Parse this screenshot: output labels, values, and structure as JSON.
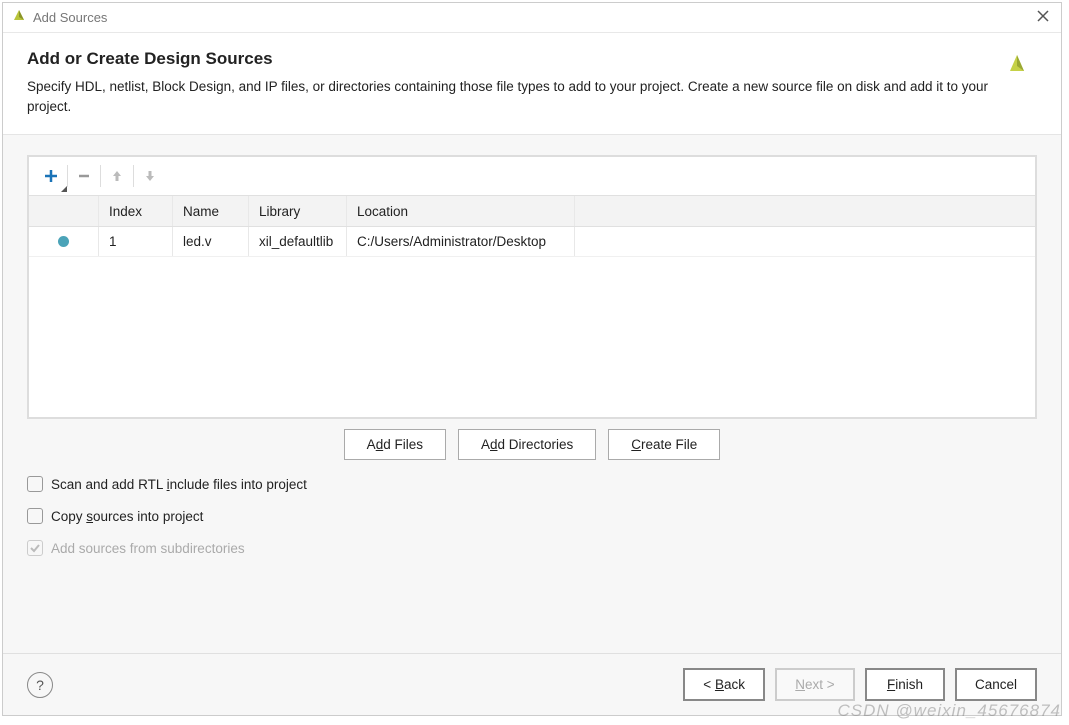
{
  "titlebar": {
    "title": "Add Sources"
  },
  "header": {
    "heading": "Add or Create Design Sources",
    "description": "Specify HDL, netlist, Block Design, and IP files, or directories containing those file types to add to your project. Create a new source file on disk and add it to your project."
  },
  "table": {
    "columns": {
      "index": "Index",
      "name": "Name",
      "library": "Library",
      "location": "Location"
    },
    "rows": [
      {
        "index": "1",
        "name": "led.v",
        "library": "xil_defaultlib",
        "location": "C:/Users/Administrator/Desktop"
      }
    ]
  },
  "actions": {
    "add_files_pre": "A",
    "add_files_u": "d",
    "add_files_post": "d Files",
    "add_dirs_pre": "A",
    "add_dirs_u": "d",
    "add_dirs_post": "d Directories",
    "create_file_pre": "",
    "create_file_u": "C",
    "create_file_post": "reate File"
  },
  "checkboxes": {
    "scan_pre": "Scan and add RTL ",
    "scan_u": "i",
    "scan_post": "nclude files into project",
    "copy_pre": "Copy ",
    "copy_u": "s",
    "copy_post": "ources into project",
    "subdir": "Add sources from subdirectories"
  },
  "footer": {
    "back_pre": "< ",
    "back_u": "B",
    "back_post": "ack",
    "next_pre": "",
    "next_u": "N",
    "next_post": "ext >",
    "finish_pre": "",
    "finish_u": "F",
    "finish_post": "inish",
    "cancel": "Cancel"
  },
  "watermark": "CSDN @weixin_45676874"
}
